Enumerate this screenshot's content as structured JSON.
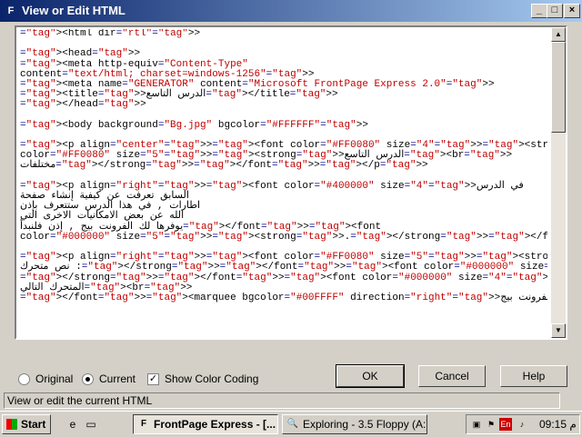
{
  "window": {
    "title": "View or Edit HTML",
    "minimize_glyph": "_",
    "maximize_glyph": "□",
    "close_glyph": "×"
  },
  "editor": {
    "lines": [
      "<html dir=\"rtl\">",
      "",
      "<head>",
      "<meta http-equiv=\"Content-Type\"",
      "content=\"text/html; charset=windows-1256\">",
      "<meta name=\"GENERATOR\" content=\"Microsoft FrontPage Express 2.0\">",
      "<title>الدرس التاسع</title>",
      "</head>",
      "",
      "<body background=\"Bg.jpg\" bgcolor=\"#FFFFFF\">",
      "",
      "<p align=\"center\"><font color=\"#FF0080\" size=\"4\"><strong>|</strong></font><font",
      "color=\"#FF0080\" size=\"5\"><strong>الدرس التاسع<br>",
      "مختلفات</strong></font></p>",
      "",
      "<p align=\"right\"><font color=\"#400000\" size=\"4\">في الدرس",
      "السابق تعرفت عن كيفية إنشاء صفحة",
      "اطارات , في هذا الدرس ستتعرف بإذن",
      "الله عن بعض الامكانيات الاخرى التي",
      "يوفرها لك الفرونت بيج , إذن فلنبدأ</font><font",
      "color=\"#000000\" size=\"5\"><strong>.</strong></font></p>",
      "",
      "<p align=\"right\"><font color=\"#FF0080\" size=\"5\"><strong>إدراج",
      "نص متحرك :</strong></font><font color=\"#000000\" size=\"5\"><strong><br>",
      "</strong></font><font color=\"#000000\" size=\"4\">لاحظ النص",
      "المتحرك التالي<br>",
      "</font><marquee bgcolor=\"#00FFFF\" direction=\"right\">موقع دروس الفرونت بيج"
    ],
    "scroll_up_glyph": "▲",
    "scroll_down_glyph": "▼"
  },
  "options": {
    "original_label": "Original",
    "current_label": "Current",
    "selected": "current",
    "show_color_coding_label": "Show Color Coding",
    "show_color_coding_checked": true,
    "check_glyph": "✓"
  },
  "buttons": {
    "ok": "OK",
    "cancel": "Cancel",
    "help": "Help"
  },
  "status_text": "View or edit the current HTML",
  "taskbar": {
    "start_label": "Start",
    "tasks": [
      {
        "label": "FrontPage Express - [...",
        "icon": "frontpage-icon",
        "active": true
      },
      {
        "label": "Exploring - 3.5 Floppy (A:)",
        "icon": "explorer-icon",
        "active": false
      }
    ],
    "tray_lang": "En",
    "clock": "09:15 م"
  },
  "colors": {
    "title_start": "#0a246a",
    "title_end": "#a6caf0",
    "tag_color": "#000080",
    "value_color": "#c00000"
  }
}
